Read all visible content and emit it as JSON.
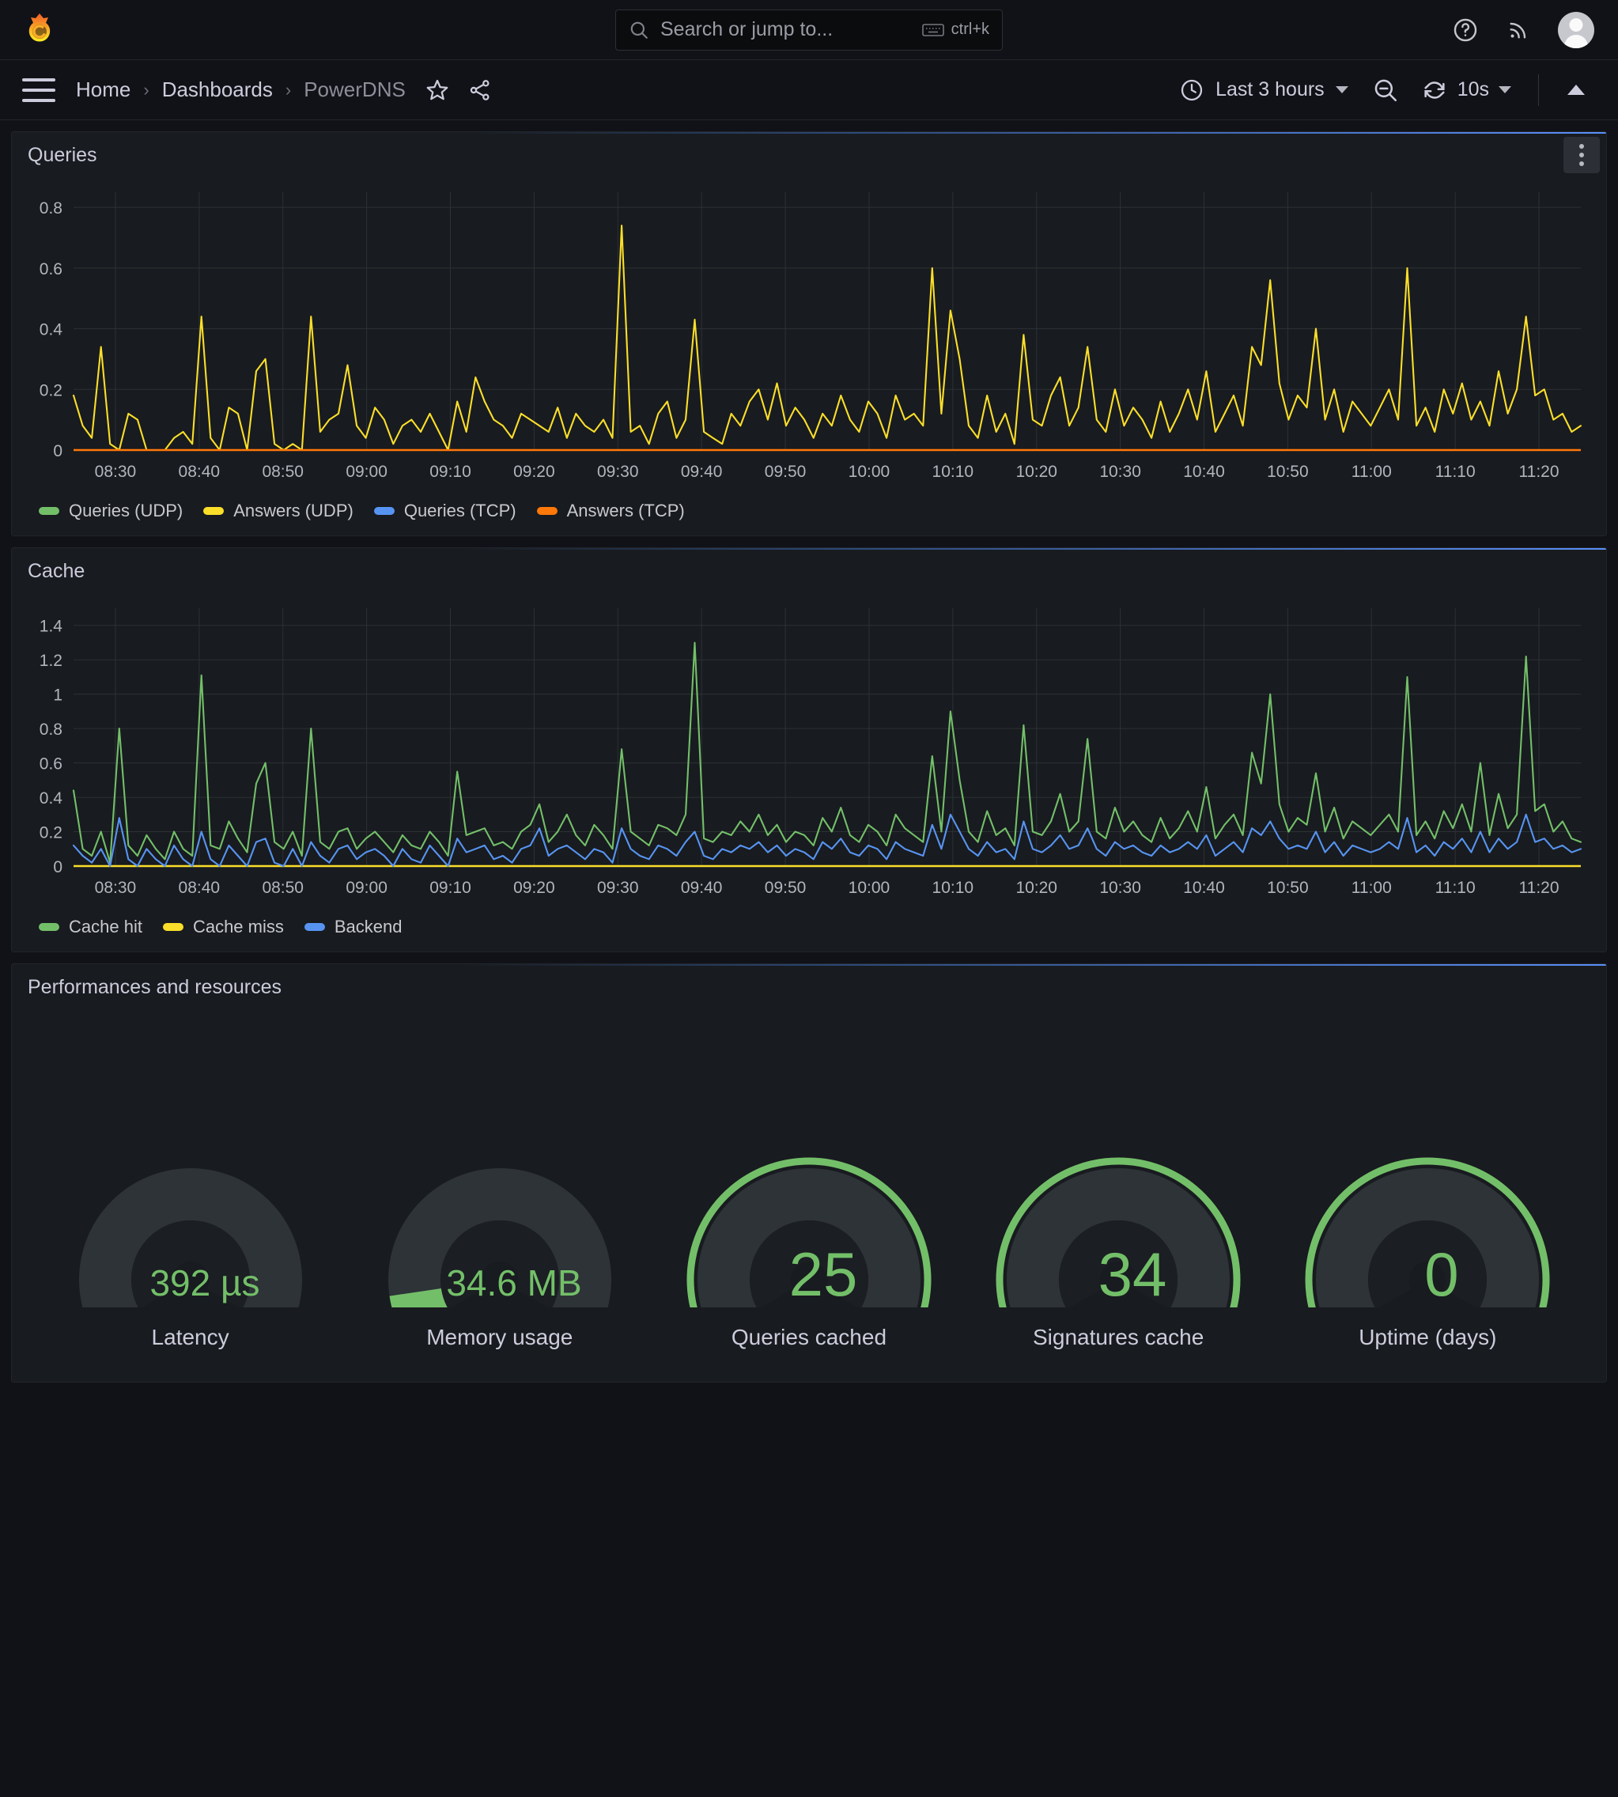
{
  "app": {
    "logo_name": "grafana-logo",
    "accent": "#5b8ff9",
    "panel_bg": "#181b1f",
    "page_bg": "#111217"
  },
  "topnav": {
    "search": {
      "placeholder": "Search or jump to...",
      "shortcut": "ctrl+k",
      "icon": "search-icon",
      "kbd_icon": "keyboard-icon"
    },
    "help_icon": "help-circle-icon",
    "news_icon": "rss-icon",
    "avatar": "user-avatar"
  },
  "subnav": {
    "menu_icon": "hamburger-menu-icon",
    "breadcrumbs": [
      {
        "label": "Home",
        "current": false
      },
      {
        "label": "Dashboards",
        "current": false
      },
      {
        "label": "PowerDNS",
        "current": true
      }
    ],
    "star_icon": "star-outline-icon",
    "share_icon": "share-nodes-icon",
    "time_range": {
      "icon": "clock-icon",
      "label": "Last 3 hours"
    },
    "zoom_out_icon": "zoom-out-icon",
    "refresh": {
      "icon": "refresh-icon",
      "interval": "10s"
    },
    "collapse_icon": "chevron-up-icon"
  },
  "panels": [
    {
      "title": "Queries",
      "menu_icon": "panel-menu-icon"
    },
    {
      "title": "Cache",
      "menu_icon": "panel-menu-icon"
    },
    {
      "title": "Performances and resources",
      "menu_icon": "panel-menu-icon"
    }
  ],
  "gauges": [
    {
      "value": "392 µs",
      "label": "Latency",
      "fraction": 0.035,
      "ring": false,
      "thick": false
    },
    {
      "value": "34.6 MB",
      "label": "Memory usage",
      "fraction": 0.09,
      "ring": false,
      "thick": true
    },
    {
      "value": "25",
      "label": "Queries cached",
      "fraction": 0.03,
      "ring": true,
      "thick": false
    },
    {
      "value": "34",
      "label": "Signatures cache",
      "fraction": 0.03,
      "ring": true,
      "thick": false
    },
    {
      "value": "0",
      "label": "Uptime (days)",
      "fraction": 0.0,
      "ring": true,
      "thick": false
    }
  ],
  "colors": {
    "green": "#73bf69",
    "yellow": "#fade2a",
    "blue": "#5794f2",
    "orange": "#ff780a",
    "axis_text": "#b3b5bd",
    "grid": "#2c3235",
    "gauge_track": "#2e3338",
    "gauge_inner": "#1b1e23"
  },
  "chart_data": [
    {
      "type": "line",
      "title": "Queries",
      "xlabel": "",
      "ylabel": "",
      "ylim": [
        0,
        0.85
      ],
      "yticks": [
        "0",
        "0.2",
        "0.4",
        "0.6",
        "0.8"
      ],
      "ytickvals": [
        0,
        0.2,
        0.4,
        0.6,
        0.8
      ],
      "xticks": [
        "08:30",
        "08:40",
        "08:50",
        "09:00",
        "09:10",
        "09:20",
        "09:30",
        "09:40",
        "09:50",
        "10:00",
        "10:10",
        "10:20",
        "10:30",
        "10:40",
        "10:50",
        "11:00",
        "11:10",
        "11:20"
      ],
      "grid": true,
      "legend_position": "bottom",
      "series": [
        {
          "name": "Queries (UDP)",
          "color": "#73bf69",
          "visible_flat": true,
          "values": []
        },
        {
          "name": "Answers (UDP)",
          "color": "#fade2a",
          "values": [
            0.18,
            0.08,
            0.04,
            0.34,
            0.02,
            0,
            0.12,
            0.1,
            0,
            0,
            0,
            0.04,
            0.06,
            0.02,
            0.44,
            0.04,
            0,
            0.14,
            0.12,
            0,
            0.26,
            0.3,
            0.02,
            0,
            0.02,
            0,
            0.44,
            0.06,
            0.1,
            0.12,
            0.28,
            0.08,
            0.04,
            0.14,
            0.1,
            0.02,
            0.08,
            0.1,
            0.06,
            0.12,
            0.06,
            0,
            0.16,
            0.06,
            0.24,
            0.16,
            0.1,
            0.08,
            0.04,
            0.12,
            0.1,
            0.08,
            0.06,
            0.14,
            0.04,
            0.12,
            0.08,
            0.06,
            0.1,
            0.04,
            0.74,
            0.06,
            0.08,
            0.02,
            0.12,
            0.16,
            0.04,
            0.1,
            0.43,
            0.06,
            0.04,
            0.02,
            0.12,
            0.08,
            0.16,
            0.2,
            0.1,
            0.22,
            0.08,
            0.14,
            0.1,
            0.04,
            0.12,
            0.08,
            0.18,
            0.1,
            0.06,
            0.16,
            0.12,
            0.04,
            0.18,
            0.1,
            0.12,
            0.08,
            0.6,
            0.12,
            0.46,
            0.3,
            0.08,
            0.04,
            0.18,
            0.06,
            0.12,
            0.02,
            0.38,
            0.1,
            0.08,
            0.18,
            0.24,
            0.08,
            0.14,
            0.34,
            0.1,
            0.06,
            0.2,
            0.08,
            0.14,
            0.1,
            0.04,
            0.16,
            0.06,
            0.12,
            0.2,
            0.1,
            0.26,
            0.06,
            0.12,
            0.18,
            0.08,
            0.34,
            0.28,
            0.56,
            0.22,
            0.1,
            0.18,
            0.14,
            0.4,
            0.1,
            0.2,
            0.06,
            0.16,
            0.12,
            0.08,
            0.14,
            0.2,
            0.1,
            0.6,
            0.08,
            0.14,
            0.06,
            0.2,
            0.12,
            0.22,
            0.1,
            0.16,
            0.08,
            0.26,
            0.12,
            0.2,
            0.44,
            0.18,
            0.2,
            0.1,
            0.12,
            0.06,
            0.08
          ]
        },
        {
          "name": "Queries (TCP)",
          "color": "#5794f2",
          "visible_flat": true,
          "values": []
        },
        {
          "name": "Answers (TCP)",
          "color": "#ff780a",
          "flat_value": 0,
          "values": []
        }
      ]
    },
    {
      "type": "line",
      "title": "Cache",
      "xlabel": "",
      "ylabel": "",
      "ylim": [
        0,
        1.5
      ],
      "yticks": [
        "0",
        "0.2",
        "0.4",
        "0.6",
        "0.8",
        "1",
        "1.2",
        "1.4"
      ],
      "ytickvals": [
        0,
        0.2,
        0.4,
        0.6,
        0.8,
        1.0,
        1.2,
        1.4
      ],
      "xticks": [
        "08:30",
        "08:40",
        "08:50",
        "09:00",
        "09:10",
        "09:20",
        "09:30",
        "09:40",
        "09:50",
        "10:00",
        "10:10",
        "10:20",
        "10:30",
        "10:40",
        "10:50",
        "11:00",
        "11:10",
        "11:20"
      ],
      "grid": true,
      "legend_position": "bottom",
      "series": [
        {
          "name": "Cache hit",
          "color": "#73bf69",
          "values": [
            0.44,
            0.1,
            0.06,
            0.2,
            0.02,
            0.8,
            0.12,
            0.06,
            0.18,
            0.1,
            0.04,
            0.2,
            0.1,
            0.06,
            1.11,
            0.12,
            0.1,
            0.26,
            0.16,
            0.08,
            0.48,
            0.6,
            0.14,
            0.1,
            0.2,
            0.06,
            0.8,
            0.14,
            0.1,
            0.2,
            0.22,
            0.1,
            0.16,
            0.2,
            0.14,
            0.08,
            0.18,
            0.12,
            0.1,
            0.2,
            0.14,
            0.06,
            0.55,
            0.18,
            0.2,
            0.22,
            0.12,
            0.14,
            0.1,
            0.2,
            0.24,
            0.36,
            0.14,
            0.2,
            0.3,
            0.18,
            0.12,
            0.24,
            0.18,
            0.1,
            0.68,
            0.2,
            0.16,
            0.12,
            0.24,
            0.22,
            0.18,
            0.3,
            1.3,
            0.16,
            0.14,
            0.2,
            0.18,
            0.26,
            0.2,
            0.3,
            0.18,
            0.24,
            0.14,
            0.2,
            0.18,
            0.12,
            0.28,
            0.2,
            0.34,
            0.18,
            0.14,
            0.24,
            0.2,
            0.12,
            0.3,
            0.22,
            0.18,
            0.14,
            0.64,
            0.2,
            0.9,
            0.5,
            0.2,
            0.14,
            0.32,
            0.18,
            0.22,
            0.12,
            0.82,
            0.2,
            0.18,
            0.26,
            0.42,
            0.2,
            0.26,
            0.74,
            0.2,
            0.16,
            0.34,
            0.2,
            0.26,
            0.18,
            0.14,
            0.28,
            0.16,
            0.22,
            0.32,
            0.2,
            0.46,
            0.16,
            0.24,
            0.3,
            0.18,
            0.66,
            0.48,
            1.0,
            0.36,
            0.2,
            0.28,
            0.24,
            0.54,
            0.2,
            0.34,
            0.16,
            0.26,
            0.22,
            0.18,
            0.24,
            0.3,
            0.2,
            1.1,
            0.18,
            0.26,
            0.16,
            0.32,
            0.22,
            0.36,
            0.2,
            0.6,
            0.18,
            0.42,
            0.22,
            0.3,
            1.22,
            0.32,
            0.36,
            0.2,
            0.26,
            0.16,
            0.14
          ]
        },
        {
          "name": "Cache miss",
          "color": "#fade2a",
          "flat_value": 0,
          "values": []
        },
        {
          "name": "Backend",
          "color": "#5794f2",
          "values": [
            0.12,
            0.06,
            0.02,
            0.1,
            0.0,
            0.28,
            0.04,
            0.0,
            0.1,
            0.04,
            0.0,
            0.12,
            0.04,
            0.0,
            0.2,
            0.04,
            0.0,
            0.12,
            0.06,
            0.0,
            0.14,
            0.16,
            0.02,
            0.0,
            0.1,
            0.0,
            0.14,
            0.06,
            0.02,
            0.1,
            0.12,
            0.04,
            0.08,
            0.1,
            0.06,
            0.0,
            0.1,
            0.04,
            0.02,
            0.12,
            0.06,
            0.0,
            0.16,
            0.08,
            0.1,
            0.12,
            0.04,
            0.06,
            0.02,
            0.1,
            0.12,
            0.22,
            0.06,
            0.1,
            0.12,
            0.08,
            0.04,
            0.1,
            0.08,
            0.02,
            0.22,
            0.1,
            0.06,
            0.04,
            0.12,
            0.1,
            0.06,
            0.14,
            0.2,
            0.06,
            0.04,
            0.1,
            0.08,
            0.12,
            0.1,
            0.14,
            0.08,
            0.12,
            0.06,
            0.1,
            0.08,
            0.04,
            0.14,
            0.1,
            0.16,
            0.08,
            0.06,
            0.12,
            0.1,
            0.04,
            0.14,
            0.1,
            0.08,
            0.06,
            0.24,
            0.1,
            0.3,
            0.2,
            0.1,
            0.06,
            0.14,
            0.08,
            0.1,
            0.04,
            0.26,
            0.1,
            0.08,
            0.12,
            0.18,
            0.1,
            0.12,
            0.22,
            0.1,
            0.06,
            0.14,
            0.1,
            0.12,
            0.08,
            0.06,
            0.12,
            0.08,
            0.1,
            0.14,
            0.1,
            0.18,
            0.06,
            0.1,
            0.14,
            0.08,
            0.22,
            0.18,
            0.26,
            0.16,
            0.1,
            0.12,
            0.1,
            0.2,
            0.08,
            0.14,
            0.06,
            0.12,
            0.1,
            0.08,
            0.1,
            0.14,
            0.1,
            0.28,
            0.08,
            0.12,
            0.06,
            0.14,
            0.1,
            0.16,
            0.08,
            0.2,
            0.08,
            0.16,
            0.1,
            0.14,
            0.3,
            0.14,
            0.16,
            0.1,
            0.12,
            0.08,
            0.1
          ]
        }
      ]
    }
  ]
}
